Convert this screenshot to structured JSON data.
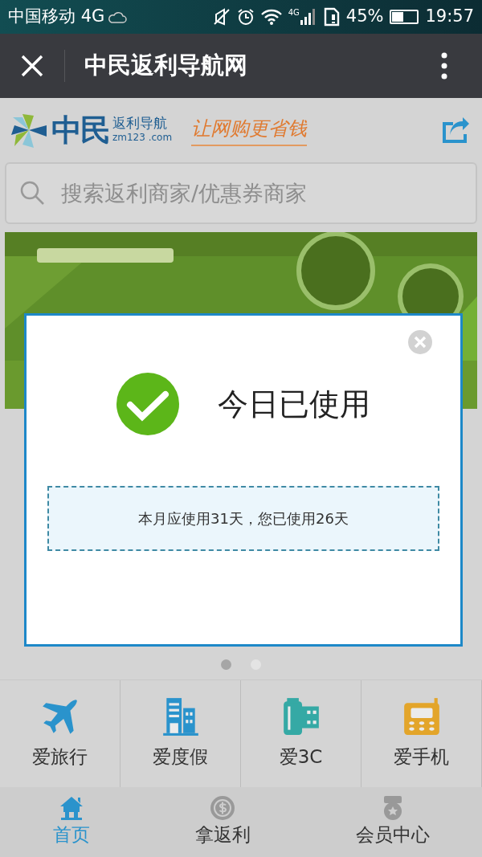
{
  "status_bar": {
    "carrier": "中国移动 4G",
    "network": "4G",
    "battery": "45%",
    "time": "19:57"
  },
  "app_bar": {
    "title": "中民返利导航网"
  },
  "header": {
    "logo_name": "中民",
    "logo_subtitle": "返利导航",
    "logo_domain": "zm123 .com",
    "slogan": "让网购更省钱"
  },
  "search": {
    "placeholder": "搜索返利商家/优惠券商家"
  },
  "carousel_dots": [
    {
      "selected": true
    },
    {
      "selected": false
    }
  ],
  "categories": [
    {
      "label": "爱旅行",
      "kind": "plane",
      "color": "#2a93cc"
    },
    {
      "label": "爱度假",
      "kind": "building",
      "color": "#2a93cc"
    },
    {
      "label": "爱3C",
      "kind": "film",
      "color": "#35a9a5"
    },
    {
      "label": "爱手机",
      "kind": "phone",
      "color": "#e3a52a"
    }
  ],
  "tabs": [
    {
      "label": "首页",
      "kind": "home",
      "selected": true
    },
    {
      "label": "拿返利",
      "kind": "coin",
      "selected": false
    },
    {
      "label": "会员中心",
      "kind": "medal",
      "selected": false
    }
  ],
  "dialog": {
    "title": "今日已使用",
    "message": "本月应使用31天，您已使用26天"
  }
}
